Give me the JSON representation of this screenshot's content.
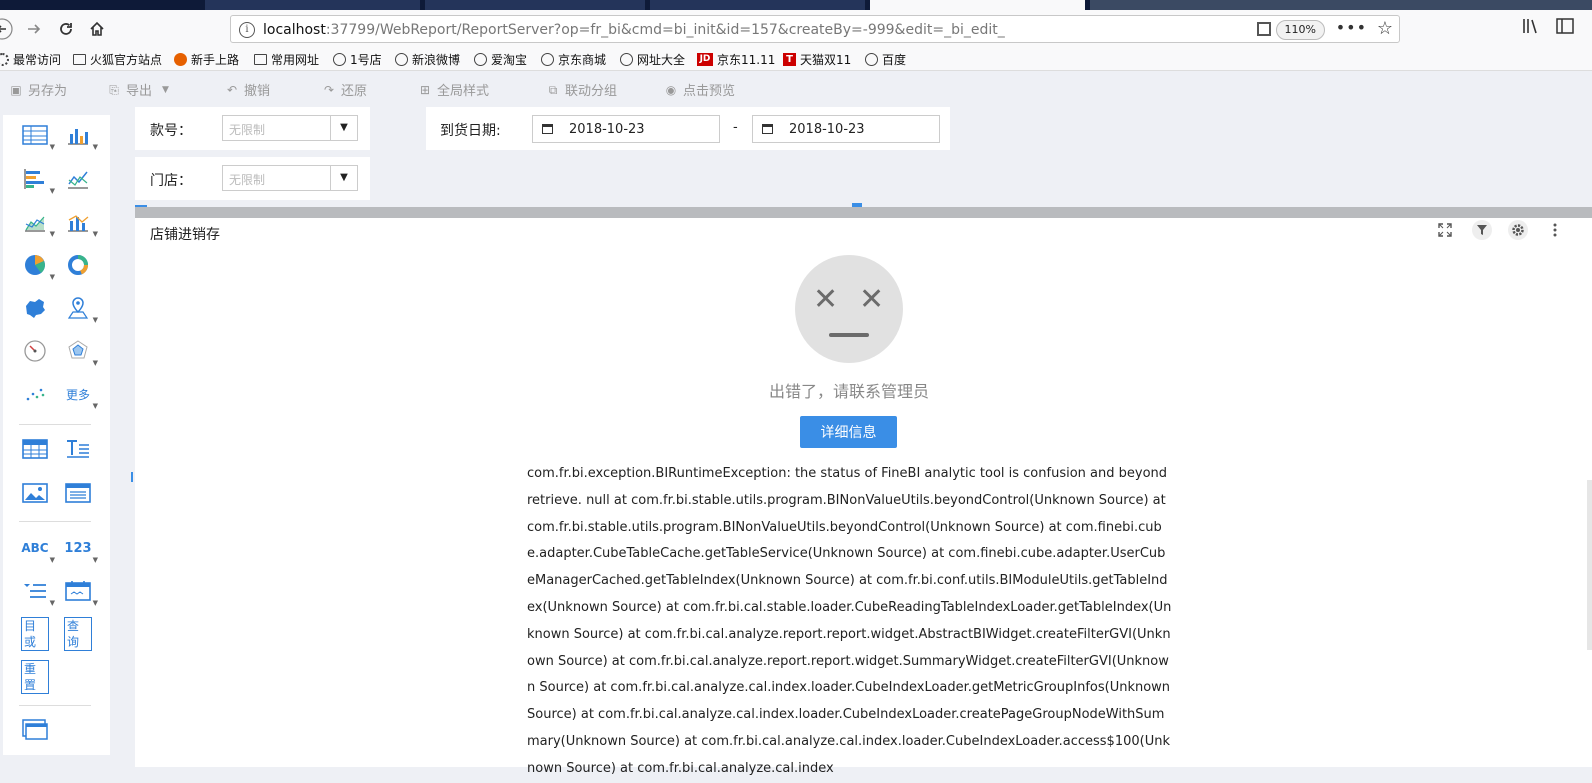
{
  "browser": {
    "url_host": "localhost",
    "url_rest": ":37799/WebReport/ReportServer?op=fr_bi&cmd=bi_init&id=157&createBy=-999&edit=_bi_edit_",
    "info_icon": "i",
    "zoom": "110%",
    "more_label": "•••",
    "bookmarks": [
      {
        "label": "最常访问",
        "icon": "gear-icon"
      },
      {
        "label": "火狐官方站点",
        "icon": "folder-icon"
      },
      {
        "label": "新手上路",
        "icon": "firefox-icon"
      },
      {
        "label": "常用网址",
        "icon": "folder-icon"
      },
      {
        "label": "1号店",
        "icon": "globe-icon"
      },
      {
        "label": "新浪微博",
        "icon": "globe-icon"
      },
      {
        "label": "爱淘宝",
        "icon": "globe-icon"
      },
      {
        "label": "京东商城",
        "icon": "globe-icon"
      },
      {
        "label": "网址大全",
        "icon": "globe-icon"
      },
      {
        "label": "京东11.11",
        "icon": "jd-icon",
        "icon_text": "JD"
      },
      {
        "label": "天猫双11",
        "icon": "tmall-icon",
        "icon_text": "T"
      },
      {
        "label": "百度",
        "icon": "globe-icon"
      }
    ]
  },
  "toolbar": {
    "save_as": "另存为",
    "export": "导出",
    "undo": "撤销",
    "redo": "还原",
    "global_style": "全局样式",
    "linked_group": "联动分组",
    "preview": "点击预览"
  },
  "palette": {
    "more": "更多",
    "abc": "ABC",
    "num": "123",
    "or_label": "目或",
    "query_label": "查询",
    "reset_label": "重置"
  },
  "filters": {
    "style_no_label": "款号：",
    "style_no_placeholder": "无限制",
    "store_label": "门店：",
    "store_placeholder": "无限制",
    "arrival_label": "到货日期:",
    "date_from": "2018-10-23",
    "date_sep": "-",
    "date_to": "2018-10-23"
  },
  "widget": {
    "title": "店铺进销存",
    "error_message": "出错了，请联系管理员",
    "detail_button": "详细信息",
    "stack_trace": "com.fr.bi.exception.BIRuntimeException: the status of FineBI analytic tool is confusion and beyond retrieve.   null    at com.fr.bi.stable.utils.program.BINonValueUtils.beyondControl(Unknown Source)    at com.fr.bi.stable.utils.program.BINonValueUtils.beyondControl(Unknown Source)    at com.finebi.cube.adapter.CubeTableCache.getTableService(Unknown Source)    at com.finebi.cube.adapter.UserCubeManagerCached.getTableIndex(Unknown Source)    at com.fr.bi.conf.utils.BIModuleUtils.getTableIndex(Unknown Source)    at com.fr.bi.cal.stable.loader.CubeReadingTableIndexLoader.getTableIndex(Unknown Source)    at com.fr.bi.cal.analyze.report.report.widget.AbstractBIWidget.createFilterGVI(Unknown Source)    at com.fr.bi.cal.analyze.report.report.widget.SummaryWidget.createFilterGVI(Unknown Source)    at com.fr.bi.cal.analyze.cal.index.loader.CubeIndexLoader.getMetricGroupInfos(Unknown Source)    at com.fr.bi.cal.analyze.cal.index.loader.CubeIndexLoader.createPageGroupNodeWithSummary(Unknown Source)    at com.fr.bi.cal.analyze.cal.index.loader.CubeIndexLoader.access$100(Unknown Source)    at com.fr.bi.cal.analyze.cal.index"
  }
}
